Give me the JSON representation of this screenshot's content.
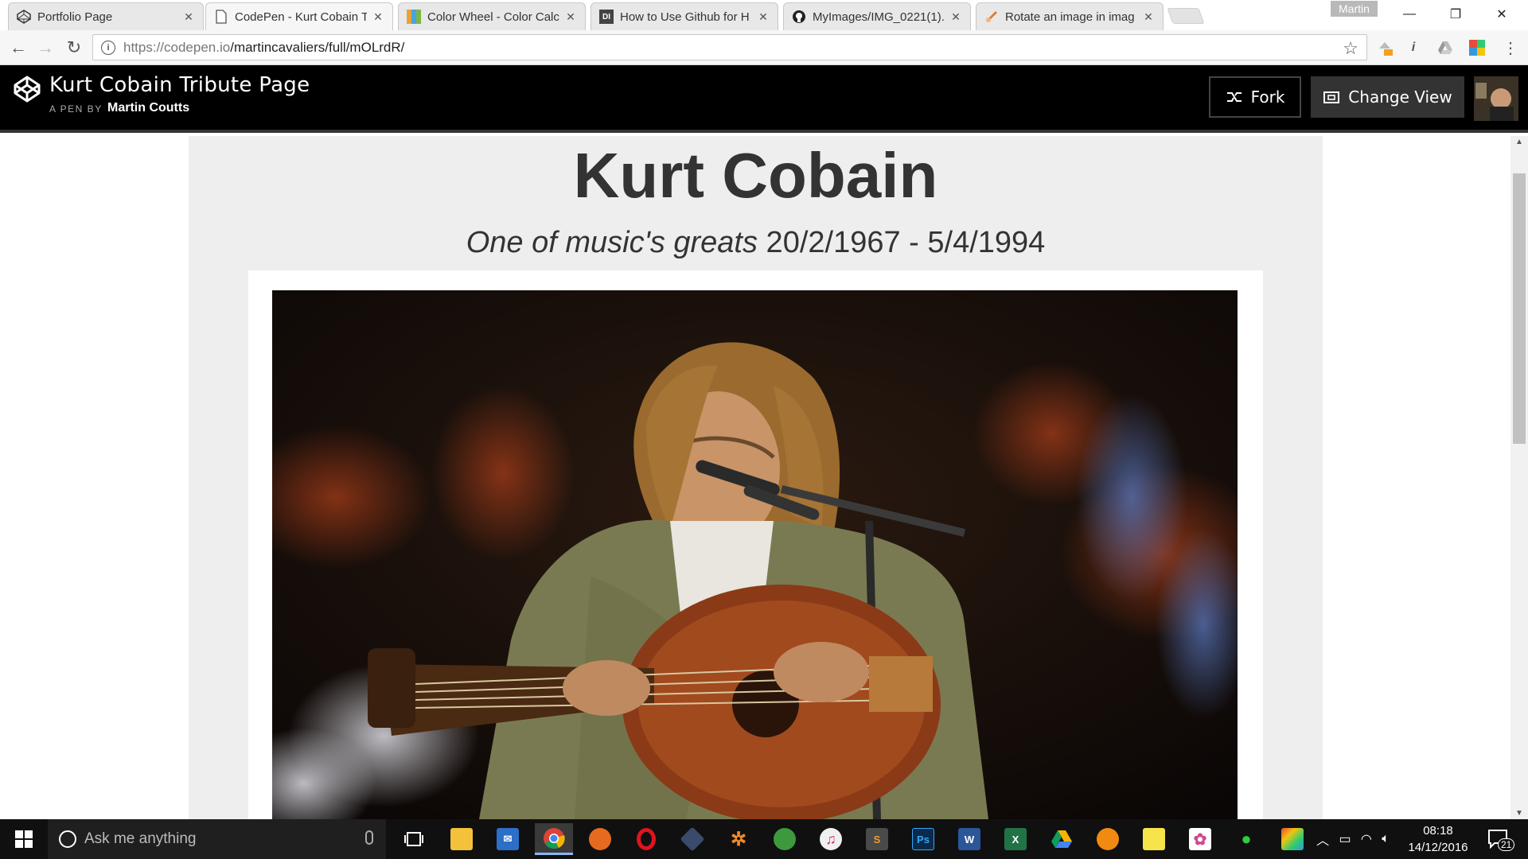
{
  "browser": {
    "tabs": [
      {
        "title": "Portfolio Page",
        "favicon": "codepen-icon",
        "active": false
      },
      {
        "title": "CodePen - Kurt Cobain T",
        "favicon": "page-icon",
        "active": true
      },
      {
        "title": "Color Wheel - Color Calc",
        "favicon": "color-wheel-icon",
        "active": false
      },
      {
        "title": "How to Use Github for H",
        "favicon": "di-icon",
        "active": false
      },
      {
        "title": "MyImages/IMG_0221(1).",
        "favicon": "github-icon",
        "active": false
      },
      {
        "title": "Rotate an image in imag",
        "favicon": "rotate-icon",
        "active": false
      }
    ],
    "profile_name": "Martin",
    "url_host": "https://codepen.io",
    "url_path": "/martincavaliers/full/mOLrdR/"
  },
  "codepen": {
    "pen_title": "Kurt Cobain Tribute Page",
    "by_label": "A PEN BY",
    "author": "Martin Coutts",
    "fork_label": "Fork",
    "change_view_label": "Change View"
  },
  "page": {
    "heading": "Kurt Cobain",
    "subtitle_italic": "One of music's greats",
    "subtitle_dates": " 20/2/1967 - 5/4/1994"
  },
  "taskbar": {
    "search_placeholder": "Ask me anything",
    "time": "08:18",
    "date": "14/12/2016",
    "notification_count": "21"
  },
  "colors": {
    "header_bg": "#000000",
    "panel_bg": "#eeeeee",
    "taskbar_bg": "#101010"
  }
}
